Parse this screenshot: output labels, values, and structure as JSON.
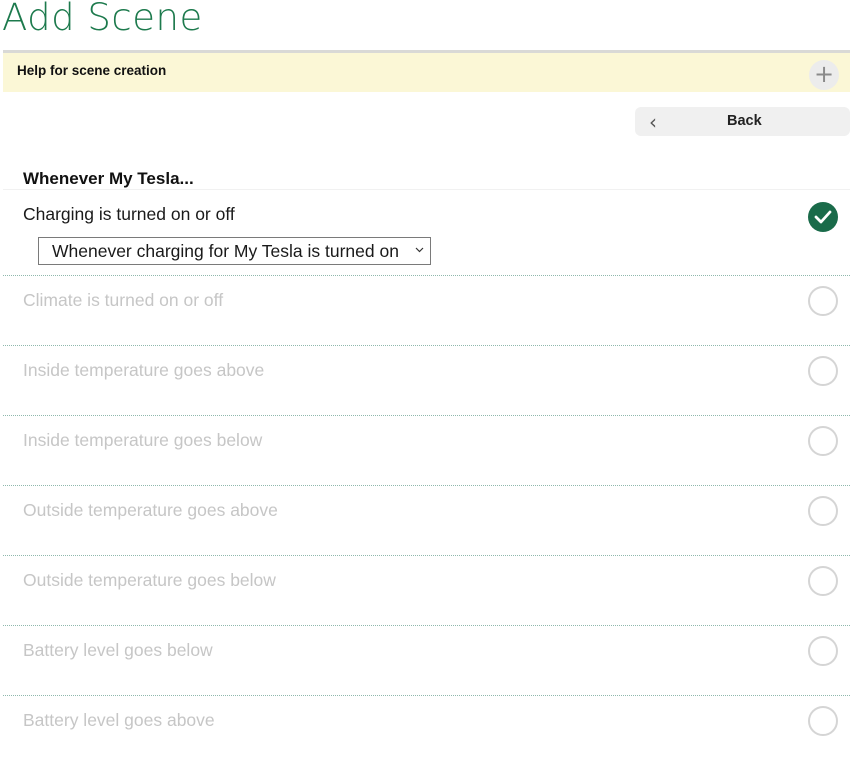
{
  "page": {
    "title": "Add Scene"
  },
  "help": {
    "label": "Help for scene creation",
    "expand_icon": "plus-icon",
    "expand_symbol": "+"
  },
  "nav": {
    "back_label": "Back",
    "back_icon": "chevron-left-icon",
    "back_symbol": "‹"
  },
  "section": {
    "heading": "Whenever My Tesla..."
  },
  "colors": {
    "accent": "#1d7a4d",
    "selected": "#1a6b4a",
    "help_bg": "#fbf7d6",
    "disabled_text": "#c6c6c6"
  },
  "triggers": [
    {
      "label": "Charging is turned on or off",
      "selected": true,
      "option": "Whenever charging for My Tesla is turned on"
    },
    {
      "label": "Climate is turned on or off",
      "selected": false
    },
    {
      "label": "Inside temperature goes above",
      "selected": false
    },
    {
      "label": "Inside temperature goes below",
      "selected": false
    },
    {
      "label": "Outside temperature goes above",
      "selected": false
    },
    {
      "label": "Outside temperature goes below",
      "selected": false
    },
    {
      "label": "Battery level goes below",
      "selected": false
    },
    {
      "label": "Battery level goes above",
      "selected": false
    }
  ]
}
